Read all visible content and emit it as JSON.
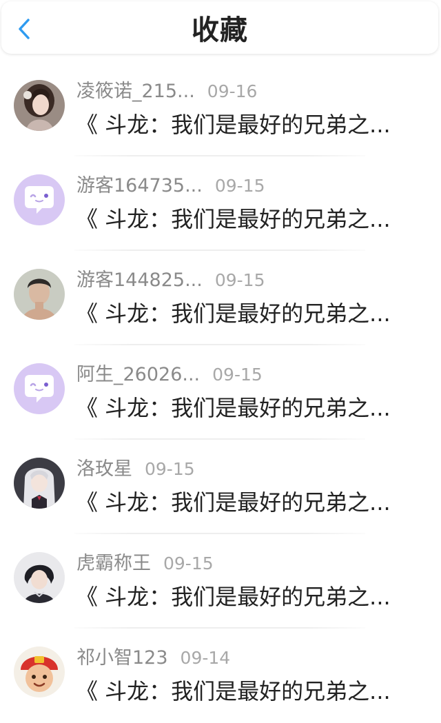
{
  "header": {
    "title": "收藏",
    "back_icon": "chevron-left-icon",
    "accent_color": "#2f9bf0"
  },
  "items": [
    {
      "name": "凌筱诺_215...",
      "date": "09-16",
      "content": "《 斗龙：我们是最好的兄弟之...",
      "avatar": "anime-girl-dark-avatar"
    },
    {
      "name": "游客164735...",
      "date": "09-15",
      "content": "《 斗龙：我们是最好的兄弟之...",
      "avatar": "purple-chat-avatar"
    },
    {
      "name": "游客144825...",
      "date": "09-15",
      "content": "《 斗龙：我们是最好的兄弟之...",
      "avatar": "young-man-avatar"
    },
    {
      "name": "阿生_26026...",
      "date": "09-15",
      "content": "《 斗龙：我们是最好的兄弟之...",
      "avatar": "purple-chat-avatar"
    },
    {
      "name": "洛玫星",
      "date": "09-15",
      "content": "《 斗龙：我们是最好的兄弟之...",
      "avatar": "anime-girl-white-hair-avatar"
    },
    {
      "name": "虎霸称王",
      "date": "09-15",
      "content": "《 斗龙：我们是最好的兄弟之...",
      "avatar": "anime-boy-avatar"
    },
    {
      "name": "祁小智123",
      "date": "09-14",
      "content": "《 斗龙：我们是最好的兄弟之...",
      "avatar": "cartoon-boy-avatar"
    }
  ]
}
